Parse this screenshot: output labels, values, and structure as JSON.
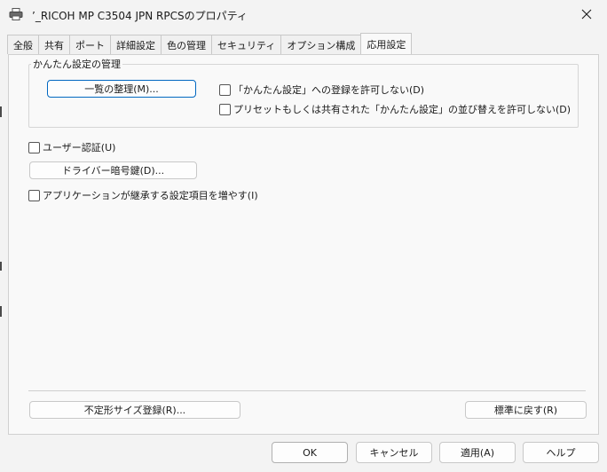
{
  "window": {
    "title": "’_RICOH MP C3504 JPN RPCSのプロパティ",
    "close_icon": "close-icon"
  },
  "tabs": [
    {
      "label": "全般"
    },
    {
      "label": "共有"
    },
    {
      "label": "ポート"
    },
    {
      "label": "詳細設定"
    },
    {
      "label": "色の管理"
    },
    {
      "label": "セキュリティ"
    },
    {
      "label": "オプション構成"
    },
    {
      "label": "応用設定",
      "active": true
    }
  ],
  "group": {
    "label": "かんたん設定の管理",
    "manage_button": "一覧の整理(M)...",
    "check1": "「かんたん設定」への登録を許可しない(D)",
    "check2": "プリセットもしくは共有された「かんたん設定」の並び替えを許可しない(D)"
  },
  "user_auth": "ユーザー認証(U)",
  "driver_key_button": "ドライバー暗号鍵(D)...",
  "app_settings": "アプリケーションが継承する設定項目を増やす(I)",
  "custom_size_button": "不定形サイズ登録(R)...",
  "restore_button": "標準に戻す(R)",
  "footer": {
    "ok": "OK",
    "cancel": "キャンセル",
    "apply": "適用(A)",
    "help": "ヘルプ"
  }
}
